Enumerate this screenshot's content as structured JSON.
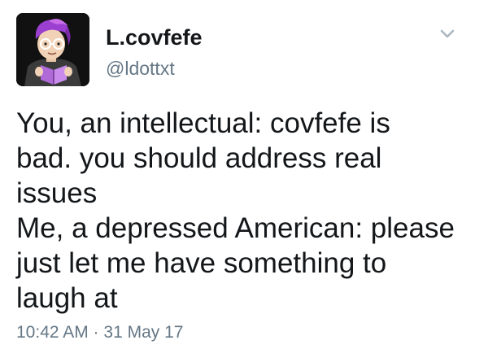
{
  "author": {
    "display_name": "L.covfefe",
    "handle": "@ldottxt",
    "avatar_icon": "cartoon-avatar-reading-book-icon"
  },
  "menu": {
    "icon": "chevron-down-icon"
  },
  "tweet": {
    "text": "You, an intellectual: covfefe is\nbad. you should address real\nissues\nMe, a depressed American: please\njust let me have something to\nlaugh at",
    "timestamp": "10:42 AM · 31 May 17"
  },
  "colors": {
    "text_primary": "#14171a",
    "text_secondary": "#657786",
    "background": "#ffffff"
  }
}
